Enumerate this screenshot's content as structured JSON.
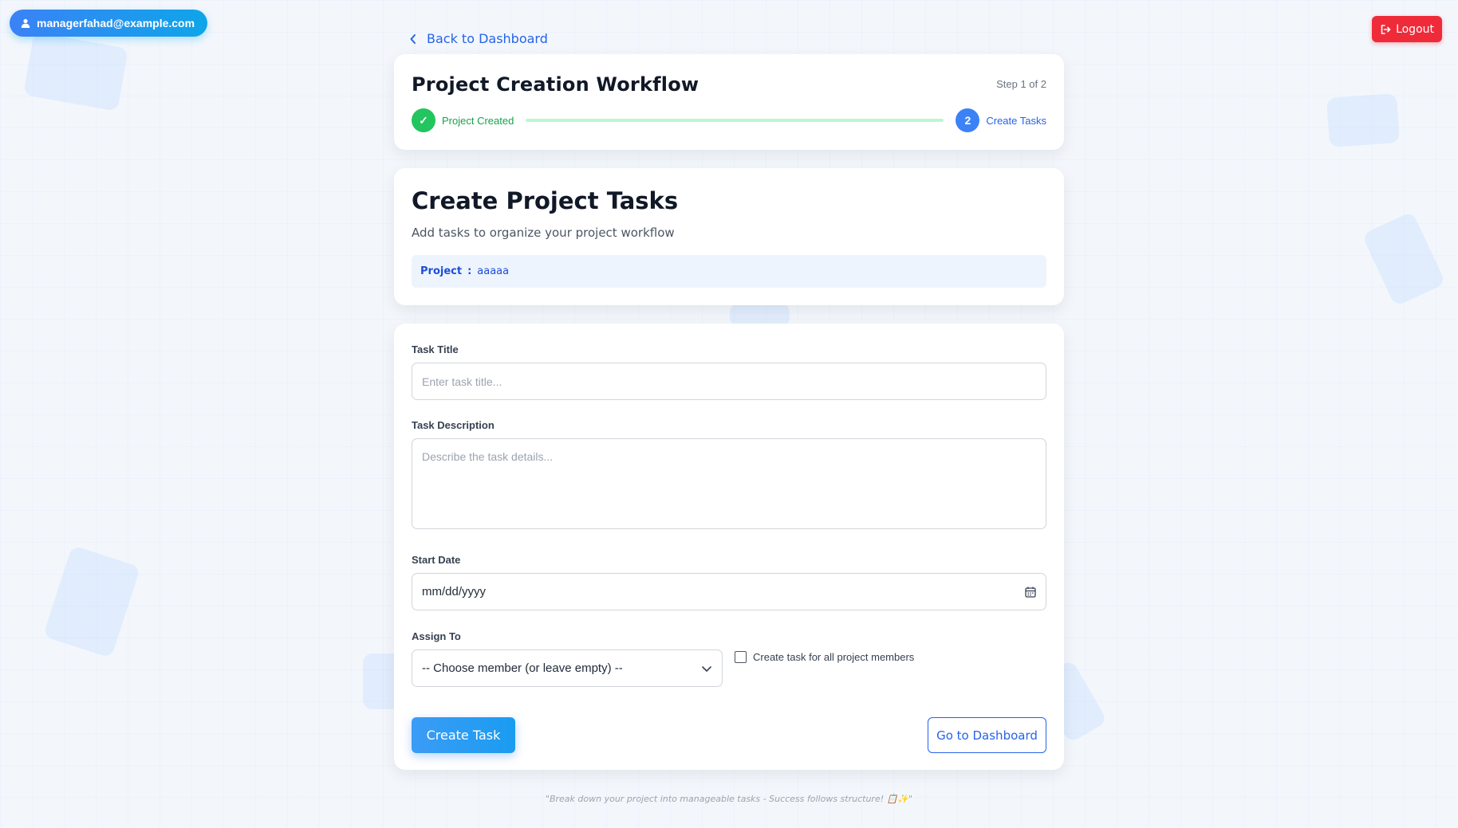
{
  "user": {
    "email": "managerfahad@example.com",
    "icon": "user-icon"
  },
  "logout": {
    "label": "Logout",
    "icon": "logout-icon"
  },
  "nav": {
    "back_label": "Back to Dashboard",
    "back_icon": "chevron-left-icon"
  },
  "workflow": {
    "title": "Project Creation Workflow",
    "step_indicator": "Step 1 of 2",
    "steps": [
      {
        "marker": "✓",
        "label": "Project Created",
        "status": "done"
      },
      {
        "marker": "2",
        "label": "Create Tasks",
        "status": "current"
      }
    ]
  },
  "header": {
    "title": "Create Project Tasks",
    "subtitle": "Add tasks to organize your project workflow",
    "project_label": "Project",
    "project_separator": ":",
    "project_name": "aaaaa"
  },
  "form": {
    "task_title_label": "Task Title",
    "task_title_placeholder": "Enter task title...",
    "task_description_label": "Task Description",
    "task_description_placeholder": "Describe the task details...",
    "start_date_label": "Start Date",
    "start_date_value": "mm/dd/yyyy",
    "assign_to_label": "Assign To",
    "assign_to_selected": "-- Choose member (or leave empty) --",
    "all_members_checkbox_label": "Create task for all project members",
    "all_members_checked": false,
    "create_button": "Create Task",
    "dashboard_button": "Go to Dashboard"
  },
  "footer": {
    "quote": "\"Break down your project into manageable tasks - Success follows structure! 📋✨\""
  },
  "colors": {
    "accent": "#3b82f6",
    "success": "#22c55e",
    "danger": "#ef2b3a",
    "background": "#f3f7fc"
  }
}
